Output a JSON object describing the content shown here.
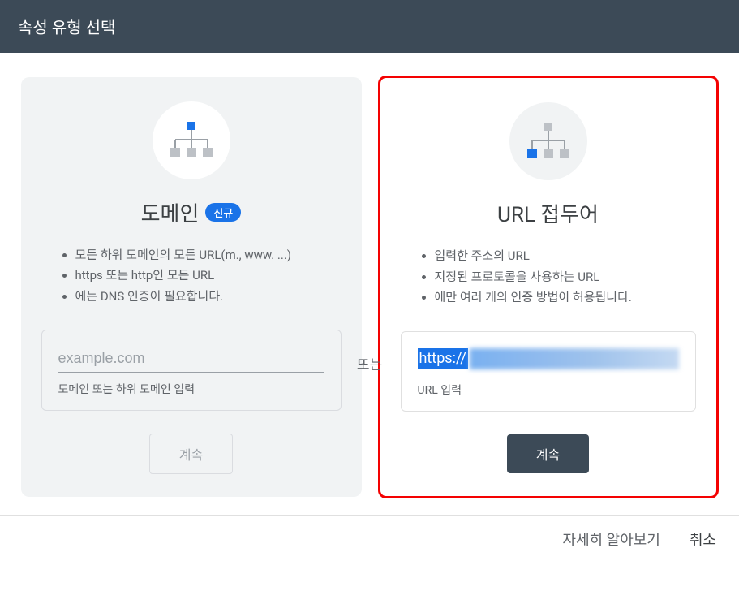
{
  "header": {
    "title": "속성 유형 선택"
  },
  "divider": "또는",
  "domain_card": {
    "title": "도메인",
    "badge": "신규",
    "bullets": [
      "모든 하위 도메인의 모든 URL(m., www. ...)",
      "https 또는 http인 모든 URL",
      "에는 DNS 인증이 필요합니다."
    ],
    "placeholder": "example.com",
    "hint": "도메인 또는 하위 도메인 입력",
    "button": "계속"
  },
  "url_card": {
    "title": "URL 접두어",
    "bullets": [
      "입력한 주소의 URL",
      "지정된 프로토콜을 사용하는 URL",
      "에만 여러 개의 인증 방법이 허용됩니다."
    ],
    "value_prefix": "https://",
    "hint": "URL 입력",
    "button": "계속"
  },
  "footer": {
    "learn_more": "자세히 알아보기",
    "cancel": "취소"
  }
}
